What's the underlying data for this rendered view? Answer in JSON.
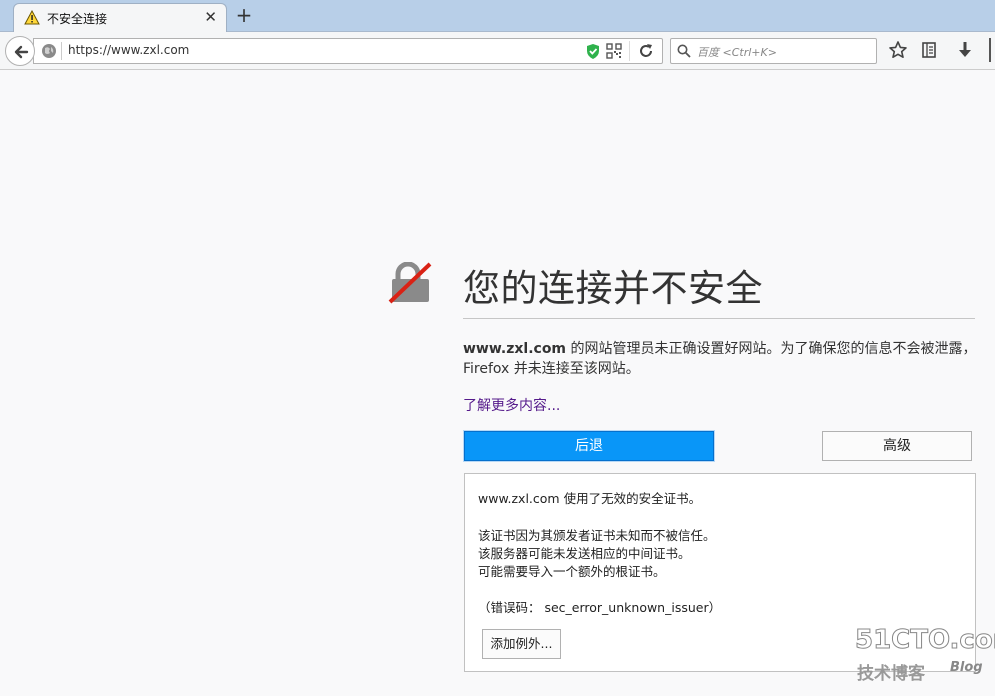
{
  "tab": {
    "title": "不安全连接",
    "close_glyph": "✕",
    "new_tab_glyph": "+"
  },
  "nav": {
    "url": "https://www.zxl.com",
    "search_placeholder": "百度 <Ctrl+K>"
  },
  "error": {
    "title": "您的连接并不安全",
    "desc_domain": "www.zxl.com",
    "desc_text": " 的网站管理员未正确设置好网站。为了确保您的信息不会被泄露，Firefox 并未连接至该网站。",
    "learn_more": "了解更多内容...",
    "back_button": "后退",
    "advanced_button": "高级"
  },
  "advanced": {
    "line1": "www.zxl.com 使用了无效的安全证书。",
    "line2": "该证书因为其颁发者证书未知而不被信任。",
    "line3": "该服务器可能未发送相应的中间证书。",
    "line4": "可能需要导入一个额外的根证书。",
    "line5": "（错误码： sec_error_unknown_issuer）",
    "add_exception_button": "添加例外..."
  },
  "watermark": {
    "main": "51CTO.com",
    "sub": "技术博客",
    "blog": "Blog"
  },
  "colors": {
    "primary_button": "#0996f8",
    "link": "#551a8b",
    "lock_slash": "#d92215"
  }
}
